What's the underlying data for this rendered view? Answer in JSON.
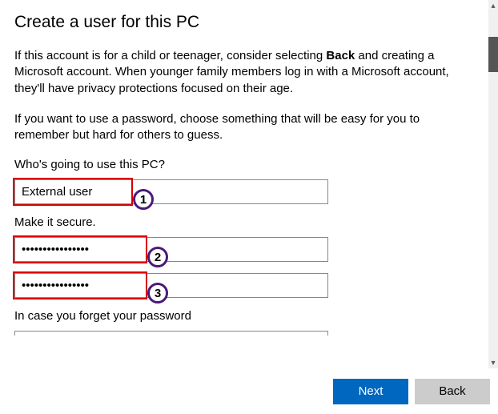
{
  "title": "Create a user for this PC",
  "para1_a": "If this account is for a child or teenager, consider selecting ",
  "para1_bold": "Back",
  "para1_b": " and creating a Microsoft account. When younger family members log in with a Microsoft account, they'll have privacy protections focused on their age.",
  "para2": "If you want to use a password, choose something that will be easy for you to remember but hard for others to guess.",
  "label_who": "Who's going to use this PC?",
  "username_value": "External user",
  "label_secure": "Make it secure.",
  "password_value": "••••••••••••••••",
  "confirm_value": "••••••••••••••••",
  "label_forget": "In case you forget your password",
  "badge1": "1",
  "badge2": "2",
  "badge3": "3",
  "btn_next": "Next",
  "btn_back": "Back"
}
